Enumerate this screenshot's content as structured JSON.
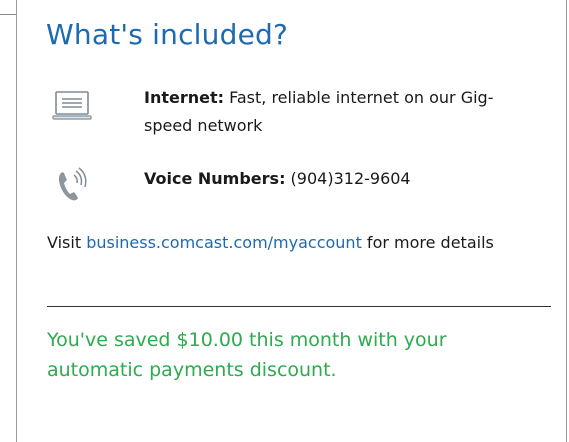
{
  "card": {
    "title": "What's included?",
    "features": [
      {
        "icon": "computer-icon",
        "label": "Internet:",
        "text": " Fast, reliable internet on our Gig-speed network"
      },
      {
        "icon": "phone-icon",
        "label": "Voice Numbers:",
        "text": " (904)312-9604"
      }
    ],
    "visit": {
      "prefix": "Visit ",
      "link_text": "business.comcast.com/myaccount",
      "suffix": " for more details"
    },
    "savings_message": "You've saved $10.00 this month with your automatic payments discount."
  },
  "colors": {
    "title": "#1e6ab0",
    "link": "#1e6ab0",
    "savings": "#2eaa4f",
    "icon": "#7f8c96"
  }
}
